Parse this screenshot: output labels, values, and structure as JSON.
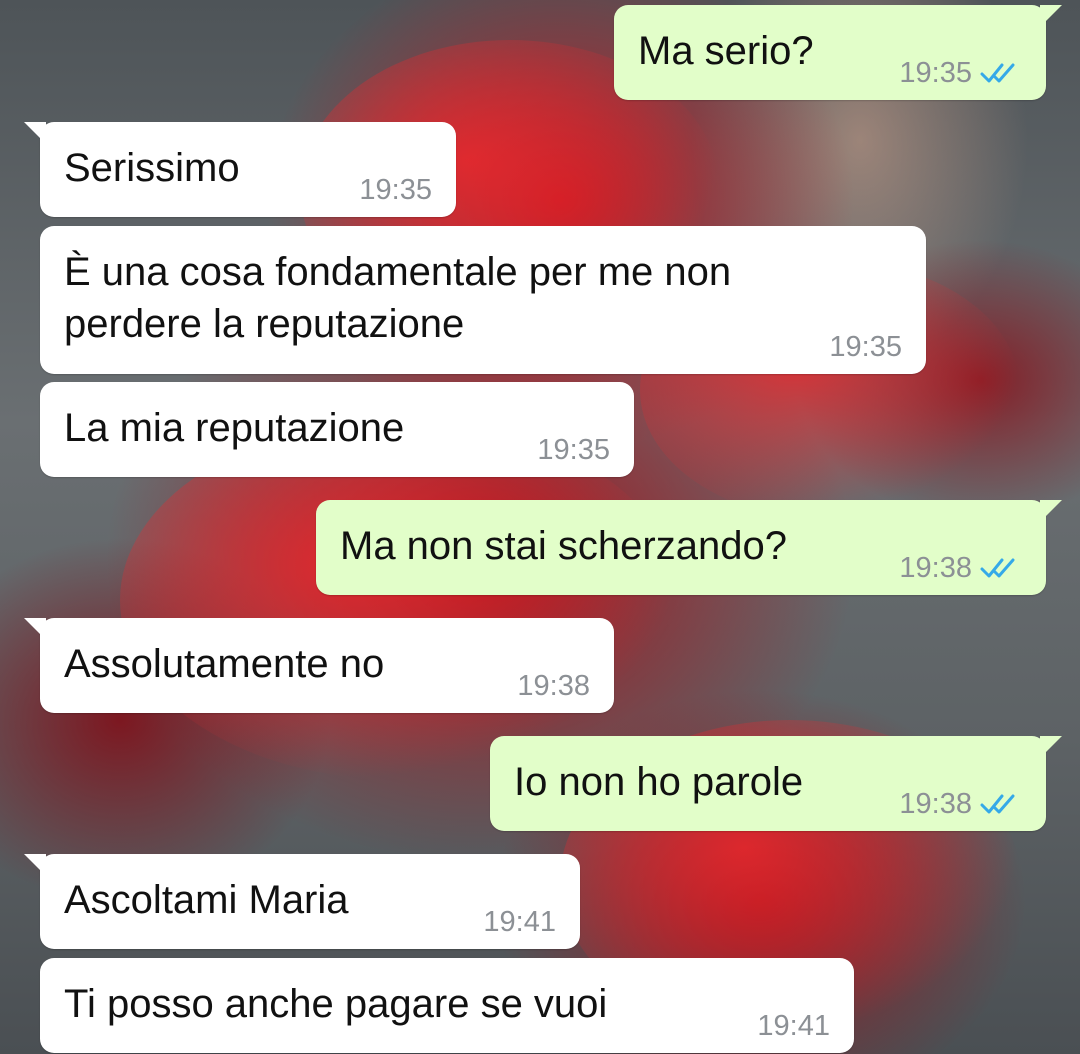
{
  "colors": {
    "incoming_bubble": "#ffffff",
    "outgoing_bubble": "#e2fec9",
    "timestamp": "#8c9095",
    "read_ticks": "#35a9e8",
    "wallpaper_accent": "#b8101c"
  },
  "wallpaper": {
    "description_icon": "red-rose-wallpaper"
  },
  "messages": [
    {
      "direction": "outgoing",
      "text": "Ma serio?",
      "time": "19:35",
      "status": "read"
    },
    {
      "direction": "incoming",
      "text": "Serissimo",
      "time": "19:35"
    },
    {
      "direction": "incoming",
      "text_line1": "È una cosa fondamentale per me non",
      "text_line2": "perdere la reputazione",
      "time": "19:35"
    },
    {
      "direction": "incoming",
      "text": "La mia reputazione",
      "time": "19:35"
    },
    {
      "direction": "outgoing",
      "text": "Ma non stai scherzando?",
      "time": "19:38",
      "status": "read"
    },
    {
      "direction": "incoming",
      "text": "Assolutamente no",
      "time": "19:38"
    },
    {
      "direction": "outgoing",
      "text": "Io non ho parole",
      "time": "19:38",
      "status": "read"
    },
    {
      "direction": "incoming",
      "text": "Ascoltami Maria",
      "time": "19:41"
    },
    {
      "direction": "incoming",
      "text": "Ti posso anche pagare se vuoi",
      "time": "19:41"
    }
  ]
}
